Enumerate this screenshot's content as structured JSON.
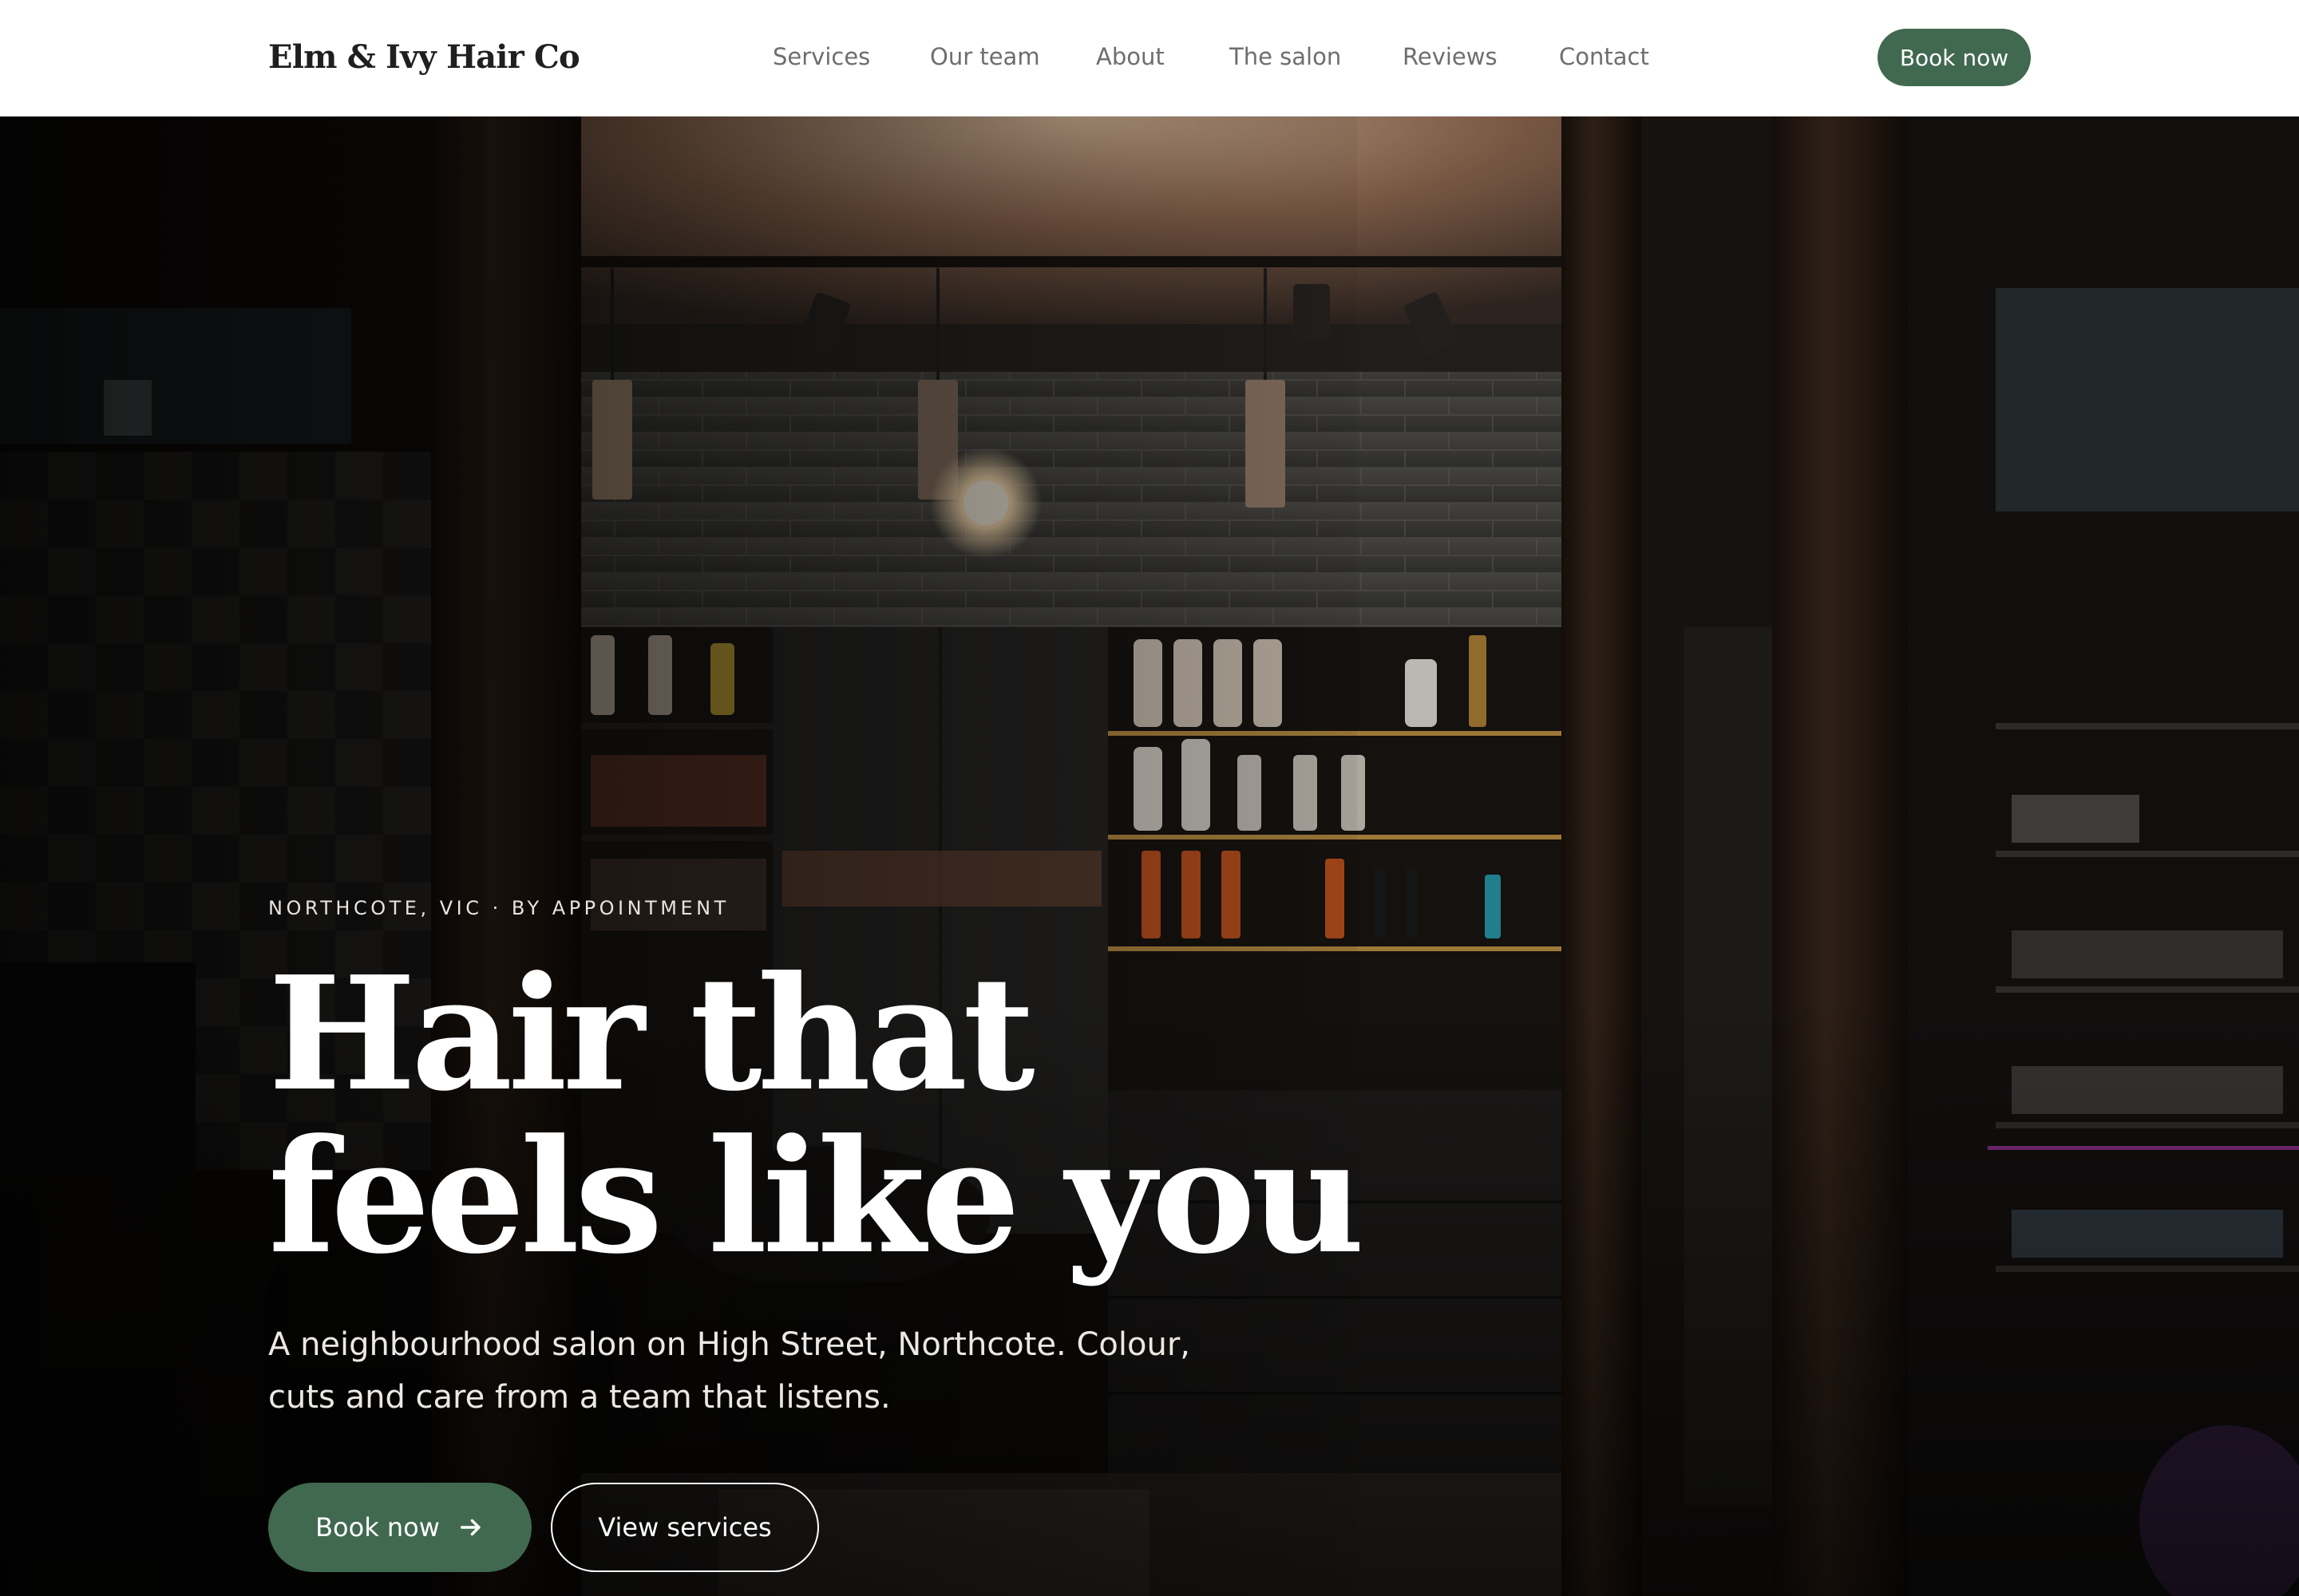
{
  "nav": {
    "brand": "Elm & Ivy Hair Co",
    "links": [
      "Services",
      "Our team",
      "About",
      "The salon",
      "Reviews",
      "Contact"
    ],
    "cta_label": "Book now"
  },
  "hero": {
    "eyebrow": "NORTHCOTE, VIC · BY APPOINTMENT",
    "headline_line1": "Hair that",
    "headline_line2": "feels like you",
    "subtext": "A neighbourhood salon on High Street, Northcote. Colour, cuts and care from a team that listens.",
    "primary_cta": "Book now",
    "primary_cta_icon": "arrow-right-icon",
    "secondary_cta": "View services"
  },
  "colors": {
    "accent_green": "#40694f",
    "nav_background": "#ffffff",
    "nav_link": "#6e6e6e",
    "brand_text": "#1f1f1f",
    "hero_text": "#ffffff"
  }
}
